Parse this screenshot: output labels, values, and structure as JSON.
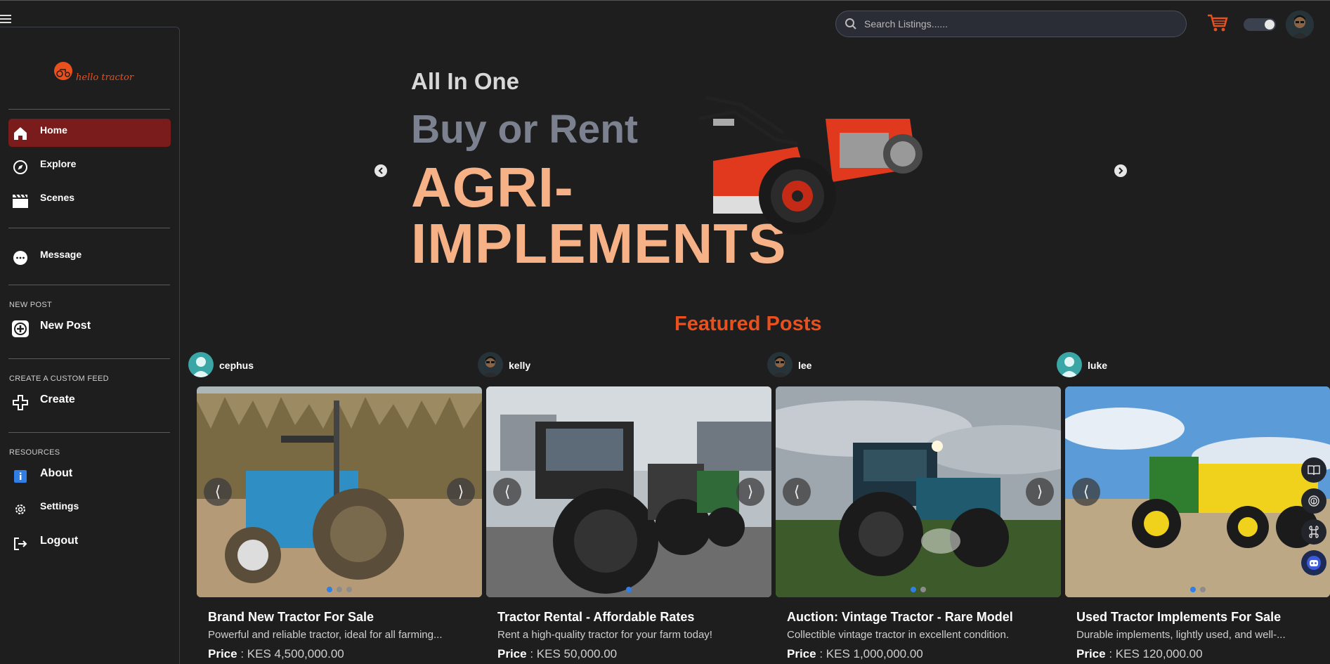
{
  "header": {
    "search_placeholder": "Search Listings......"
  },
  "sidebar": {
    "logo_text": "hello tractor",
    "items": [
      {
        "label": "Home",
        "icon": "home-icon",
        "active": true
      },
      {
        "label": "Explore",
        "icon": "compass-icon"
      },
      {
        "label": "Scenes",
        "icon": "clapperboard-icon"
      }
    ],
    "message_label": "Message",
    "new_post_section": "NEW POST",
    "new_post_label": "New Post",
    "custom_feed_section": "CREATE A CUSTOM FEED",
    "create_label": "Create",
    "resources_section": "RESOURCES",
    "about_label": "About",
    "settings_label": "Settings",
    "logout_label": "Logout"
  },
  "hero": {
    "subtitle": "All In One",
    "middle": "Buy or Rent",
    "title_line1": "AGRI-",
    "title_line2": "IMPLEMENTS"
  },
  "featured": {
    "title": "Featured Posts",
    "posts": [
      {
        "author": "cephus",
        "title": "Brand New Tractor For Sale",
        "description": "Powerful and reliable tractor, ideal for all farming...",
        "price_label": "Price",
        "price": "KES 4,500,000.00",
        "image_dots": 3,
        "active_dot": 1
      },
      {
        "author": "kelly",
        "title": "Tractor Rental - Affordable Rates",
        "description": "Rent a high-quality tractor for your farm today!",
        "price_label": "Price",
        "price": "KES 50,000.00",
        "image_dots": 1,
        "active_dot": 1
      },
      {
        "author": "lee",
        "title": "Auction: Vintage Tractor - Rare Model",
        "description": "Collectible vintage tractor in excellent condition.",
        "price_label": "Price",
        "price": "KES 1,000,000.00",
        "image_dots": 2,
        "active_dot": 1
      },
      {
        "author": "luke",
        "title": "Used Tractor Implements For Sale",
        "description": "Durable implements, lightly used, and well-...",
        "price_label": "Price",
        "price": "KES 120,000.00",
        "image_dots": 2,
        "active_dot": 1
      }
    ]
  },
  "colors": {
    "accent": "#e8501e",
    "active_nav": "#7a1c1c",
    "hero_big": "#f7b187",
    "background": "#1e1e1e"
  }
}
